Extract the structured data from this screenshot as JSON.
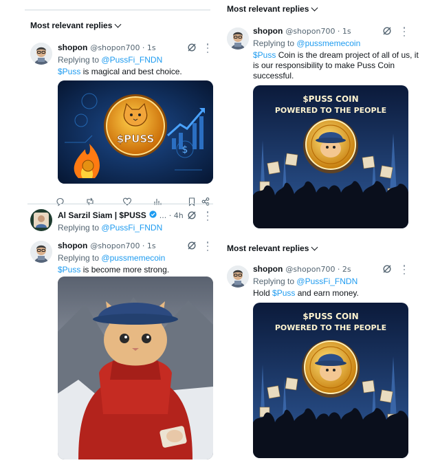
{
  "left": {
    "relevance_label": "Most relevant replies",
    "tweet1": {
      "name": "shopon",
      "handle": "@shopon700 · 1s",
      "replying_prefix": "Replying to",
      "replying_to": "@PussFi_FNDN",
      "cashtag": "$Puss",
      "text_rest": " is magical and best choice.",
      "image_text": "$PUSS"
    },
    "actions": [
      "reply-icon",
      "retweet-icon",
      "like-icon",
      "views-icon",
      "bookmark-icon",
      "share-icon"
    ],
    "tweet2": {
      "name": "Al Sarzil Siam | $PUSS",
      "verified": true,
      "handle": "... · 4h",
      "replying_prefix": "Replying to",
      "replying_to": "@PussFi_FNDN"
    },
    "tweet3": {
      "name": "shopon",
      "handle": "@shopon700 · 1s",
      "replying_prefix": "Replying to",
      "replying_to": "@pussmemecoin",
      "cashtag": "$Puss",
      "text_rest": " is become more strong."
    }
  },
  "right_top": {
    "relevance_label": "Most relevant replies",
    "tweet": {
      "name": "shopon",
      "handle": "@shopon700 · 1s",
      "replying_prefix": "Replying to",
      "replying_to": "@pussmemecoin",
      "cashtag": "$Puss",
      "text_rest": " Coin is the dream project of all of us, it is our responsibility to make Puss Coin successful.",
      "poster_line1": "$PUSS COIN",
      "poster_line2": "POWERED TO THE PEOPLE"
    }
  },
  "right_bottom": {
    "relevance_label": "Most relevant replies",
    "tweet": {
      "name": "shopon",
      "handle": "@shopon700 · 2s",
      "replying_prefix": "Replying to",
      "replying_to": "@PussFi_FNDN",
      "text_before": "Hold ",
      "cashtag": "$Puss",
      "text_rest": " and earn money.",
      "poster_line1": "$PUSS COIN",
      "poster_line2": "POWERED TO THE PEOPLE"
    }
  },
  "colors": {
    "link": "#1d9bf0",
    "secondary_text": "#536471",
    "primary_text": "#0f1419",
    "coin_gold": "#f2a016",
    "poster_navy": "#10244a"
  }
}
